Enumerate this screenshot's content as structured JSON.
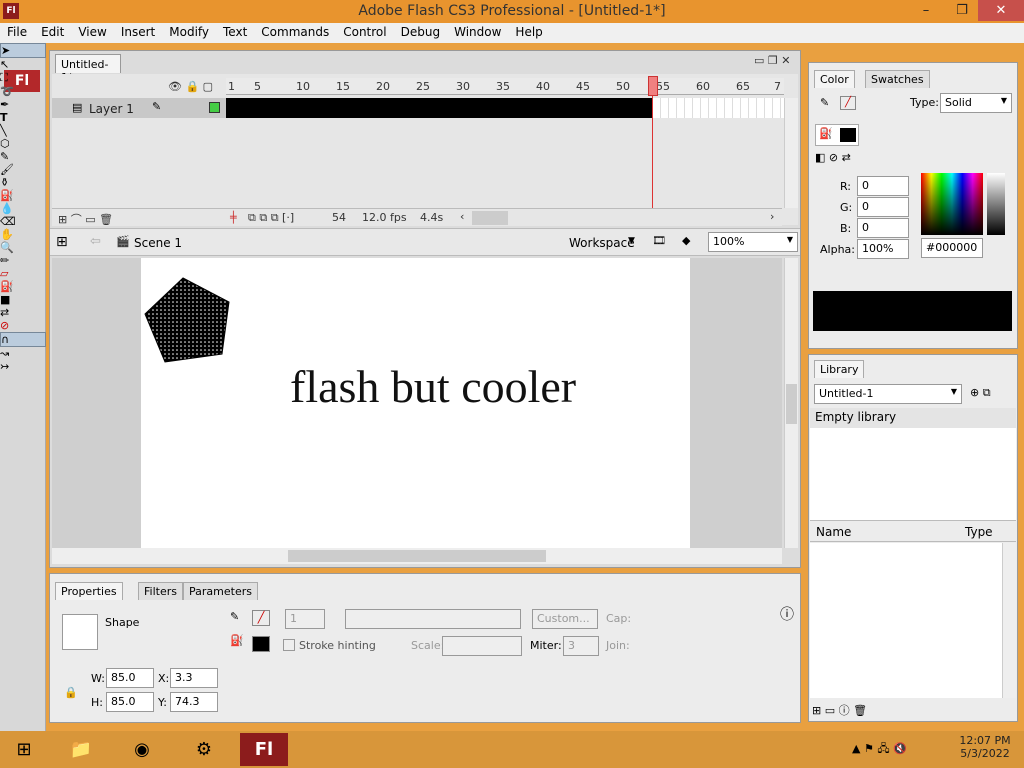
{
  "window": {
    "title": "Adobe Flash CS3 Professional - [Untitled-1*]",
    "logo": "Fl",
    "minimize": "–",
    "restore": "❐",
    "close": "✕"
  },
  "menu": [
    "File",
    "Edit",
    "View",
    "Insert",
    "Modify",
    "Text",
    "Commands",
    "Control",
    "Debug",
    "Window",
    "Help"
  ],
  "tools": {
    "logo": "Fl"
  },
  "document": {
    "tab": "Untitled-1*",
    "layer_name": "Layer 1",
    "frame_numbers": [
      "1",
      "5",
      "10",
      "15",
      "20",
      "25",
      "30",
      "35",
      "40",
      "45",
      "50",
      "55",
      "60",
      "65",
      "7"
    ],
    "status": {
      "frame": "54",
      "fps": "12.0 fps",
      "time": "4.4s"
    },
    "scene": "Scene 1",
    "workspace": "Workspace",
    "zoom": "100%",
    "stage_text": "flash but cooler"
  },
  "properties": {
    "tabs": [
      "Properties",
      "Filters",
      "Parameters"
    ],
    "selection": "Shape",
    "stroke_width": "1",
    "custom_btn": "Custom...",
    "cap_label": "Cap:",
    "stroke_hinting": "Stroke hinting",
    "scale_label": "Scale:",
    "miter_label": "Miter:",
    "miter": "3",
    "join_label": "Join:",
    "w_label": "W:",
    "w": "85.0",
    "h_label": "H:",
    "h": "85.0",
    "x_label": "X:",
    "x": "3.3",
    "y_label": "Y:",
    "y": "74.3"
  },
  "color": {
    "tabs": [
      "Color",
      "Swatches"
    ],
    "type_label": "Type:",
    "type": "Solid",
    "r_label": "R:",
    "r": "0",
    "g_label": "G:",
    "g": "0",
    "b_label": "B:",
    "b": "0",
    "alpha_label": "Alpha:",
    "alpha": "100%",
    "hex": "#000000"
  },
  "library": {
    "tab": "Library",
    "doc": "Untitled-1",
    "empty": "Empty library",
    "col_name": "Name",
    "col_type": "Type"
  },
  "clock": {
    "time": "12:07 PM",
    "date": "5/3/2022"
  },
  "colors": {
    "accent": "#e8942e",
    "frames": "#000000",
    "fill": "#000000"
  }
}
